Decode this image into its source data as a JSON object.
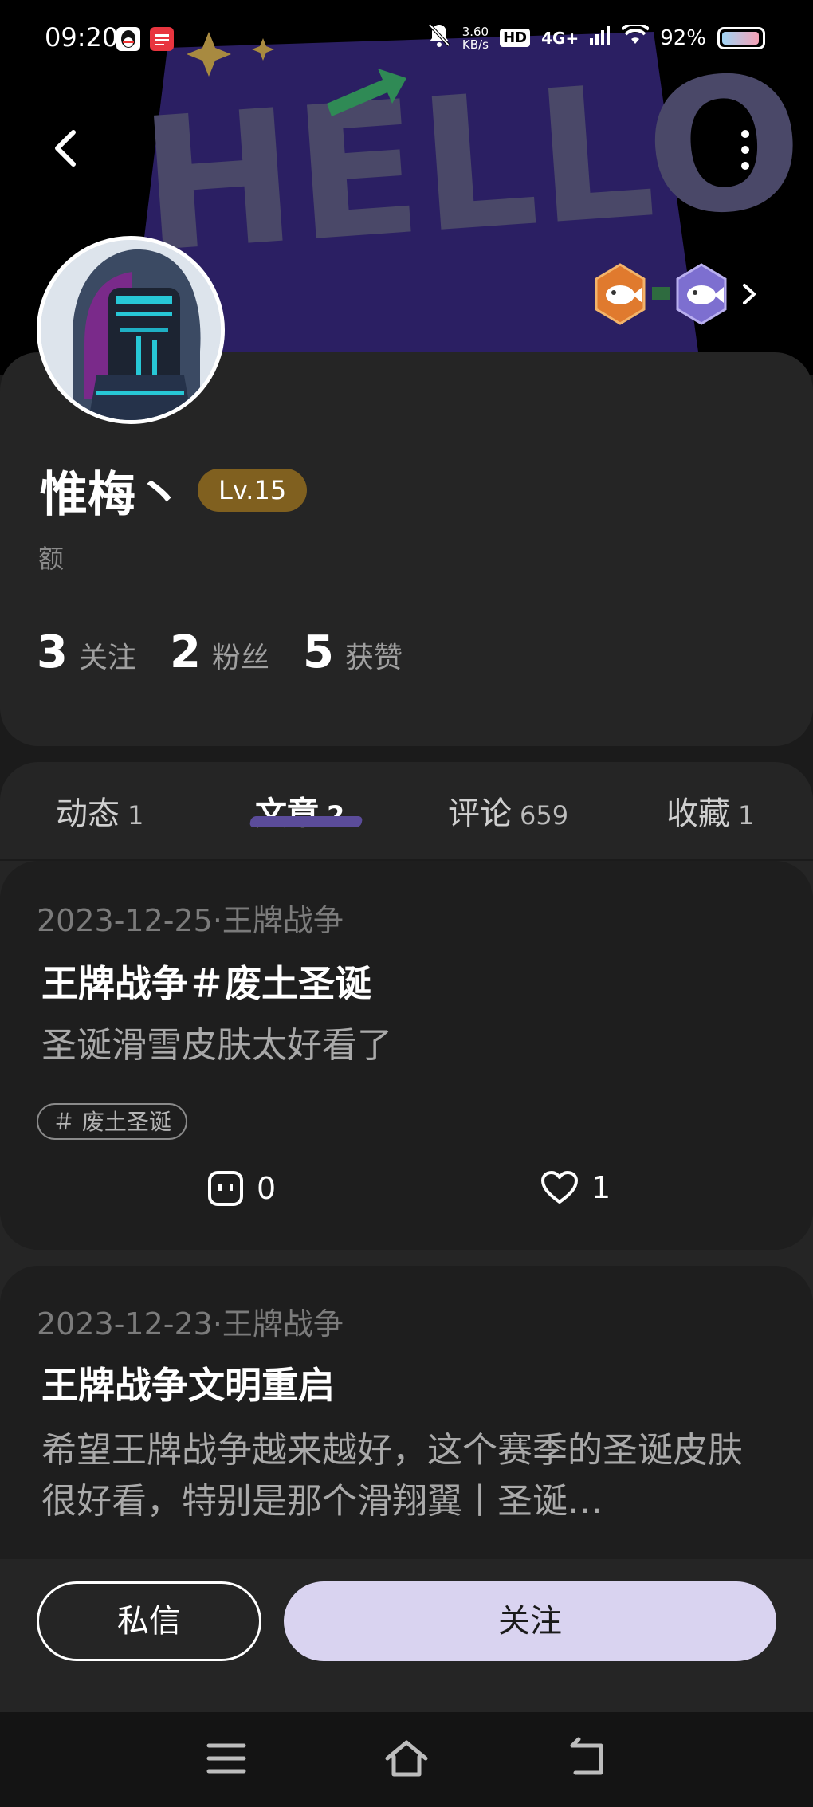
{
  "status_bar": {
    "time": "09:20",
    "net_speed_value": "3.60",
    "net_speed_unit": "KB/s",
    "hd": "HD",
    "signal": "4G+",
    "battery": "92%"
  },
  "banner": {
    "text": "HELLO.MOYU"
  },
  "profile": {
    "username": "惟梅丶",
    "level": "Lv.15",
    "bio": "额",
    "stats": [
      {
        "num": "3",
        "label": "关注"
      },
      {
        "num": "2",
        "label": "粉丝"
      },
      {
        "num": "5",
        "label": "获赞"
      }
    ]
  },
  "tabs": [
    {
      "label": "动态",
      "count": "1"
    },
    {
      "label": "文章",
      "count": "2"
    },
    {
      "label": "评论",
      "count": "659"
    },
    {
      "label": "收藏",
      "count": "1"
    }
  ],
  "posts": [
    {
      "meta": "2023-12-25·王牌战争",
      "title": "王牌战争＃废土圣诞",
      "excerpt": "圣诞滑雪皮肤太好看了",
      "tag": "＃ 废土圣诞",
      "comments": "0",
      "likes": "1"
    },
    {
      "meta": "2023-12-23·王牌战争",
      "title": "王牌战争文明重启",
      "excerpt": "希望王牌战争越来越好，这个赛季的圣诞皮肤很好看，特别是那个滑翔翼丨圣诞…"
    }
  ],
  "actions": {
    "message": "私信",
    "follow": "关注"
  },
  "colors": {
    "accent": "#d9d3f0",
    "level_badge": "#80601f",
    "tab_underline": "#5b4c9a",
    "card": "#252525"
  }
}
